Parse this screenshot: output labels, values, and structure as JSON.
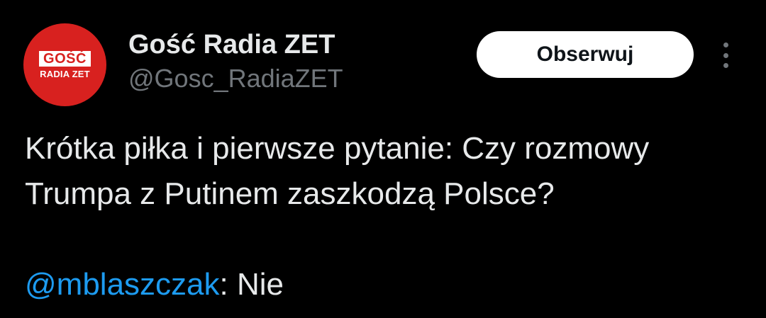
{
  "author": {
    "avatar": {
      "line1": "GOŚĆ",
      "line2": "RADIA ZET",
      "background_color": "#d8211f"
    },
    "display_name": "Gość Radia ZET",
    "handle": "@Gosc_RadiaZET"
  },
  "actions": {
    "follow_label": "Obserwuj",
    "more_icon": "more-vertical-icon"
  },
  "tweet": {
    "text": "Krótka piłka i pierwsze pytanie: Czy rozmowy Trumpa z Putinem zaszkodzą Polsce?",
    "mention": "@mblaszczak",
    "answer": ": Nie"
  },
  "colors": {
    "background": "#000000",
    "text": "#e7e9ea",
    "secondary_text": "#71767b",
    "link": "#1d9bf0"
  }
}
